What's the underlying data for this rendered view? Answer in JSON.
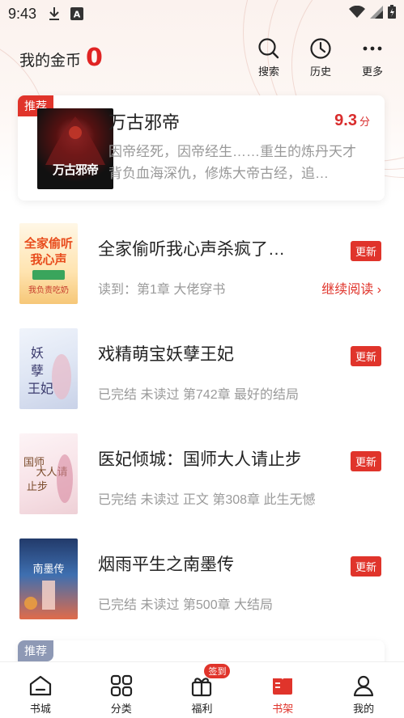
{
  "status_bar": {
    "time": "9:43"
  },
  "header": {
    "coins_label": "我的金币",
    "coins_value": "0",
    "actions": [
      {
        "label": "搜索",
        "icon": "search-icon"
      },
      {
        "label": "历史",
        "icon": "clock-icon"
      },
      {
        "label": "更多",
        "icon": "more-icon"
      }
    ]
  },
  "featured": {
    "tag": "推荐",
    "title": "万古邪帝",
    "score": "9.3",
    "score_unit": "分",
    "description": "因帝经死，因帝经生……重生的炼丹天才背负血海深仇，修炼大帝古经，追…",
    "cover_text": "万古邪帝"
  },
  "books": [
    {
      "title": "全家偷听我心声杀疯了…",
      "meta": "读到：第1章 大佬穿书",
      "badge": "更新",
      "continue": "继续阅读 ›"
    },
    {
      "title": "戏精萌宝妖孽王妃",
      "meta": "已完结 未读过 第742章  最好的结局",
      "badge": "更新"
    },
    {
      "title": "医妃倾城：国师大人请止步",
      "meta": "已完结 未读过 正文 第308章 此生无憾",
      "badge": "更新"
    },
    {
      "title": "烟雨平生之南墨传",
      "meta": "已完结 未读过 第500章 大结局",
      "badge": "更新"
    }
  ],
  "recommend": {
    "tag": "推荐"
  },
  "nav": {
    "items": [
      {
        "label": "书城",
        "icon": "home-icon"
      },
      {
        "label": "分类",
        "icon": "category-icon"
      },
      {
        "label": "福利",
        "icon": "gift-icon",
        "badge": "签到"
      },
      {
        "label": "书架",
        "icon": "bookshelf-icon",
        "active": true
      },
      {
        "label": "我的",
        "icon": "profile-icon"
      }
    ]
  },
  "colors": {
    "accent": "#e0342b",
    "text": "#222222",
    "muted": "#9a9a9a"
  }
}
